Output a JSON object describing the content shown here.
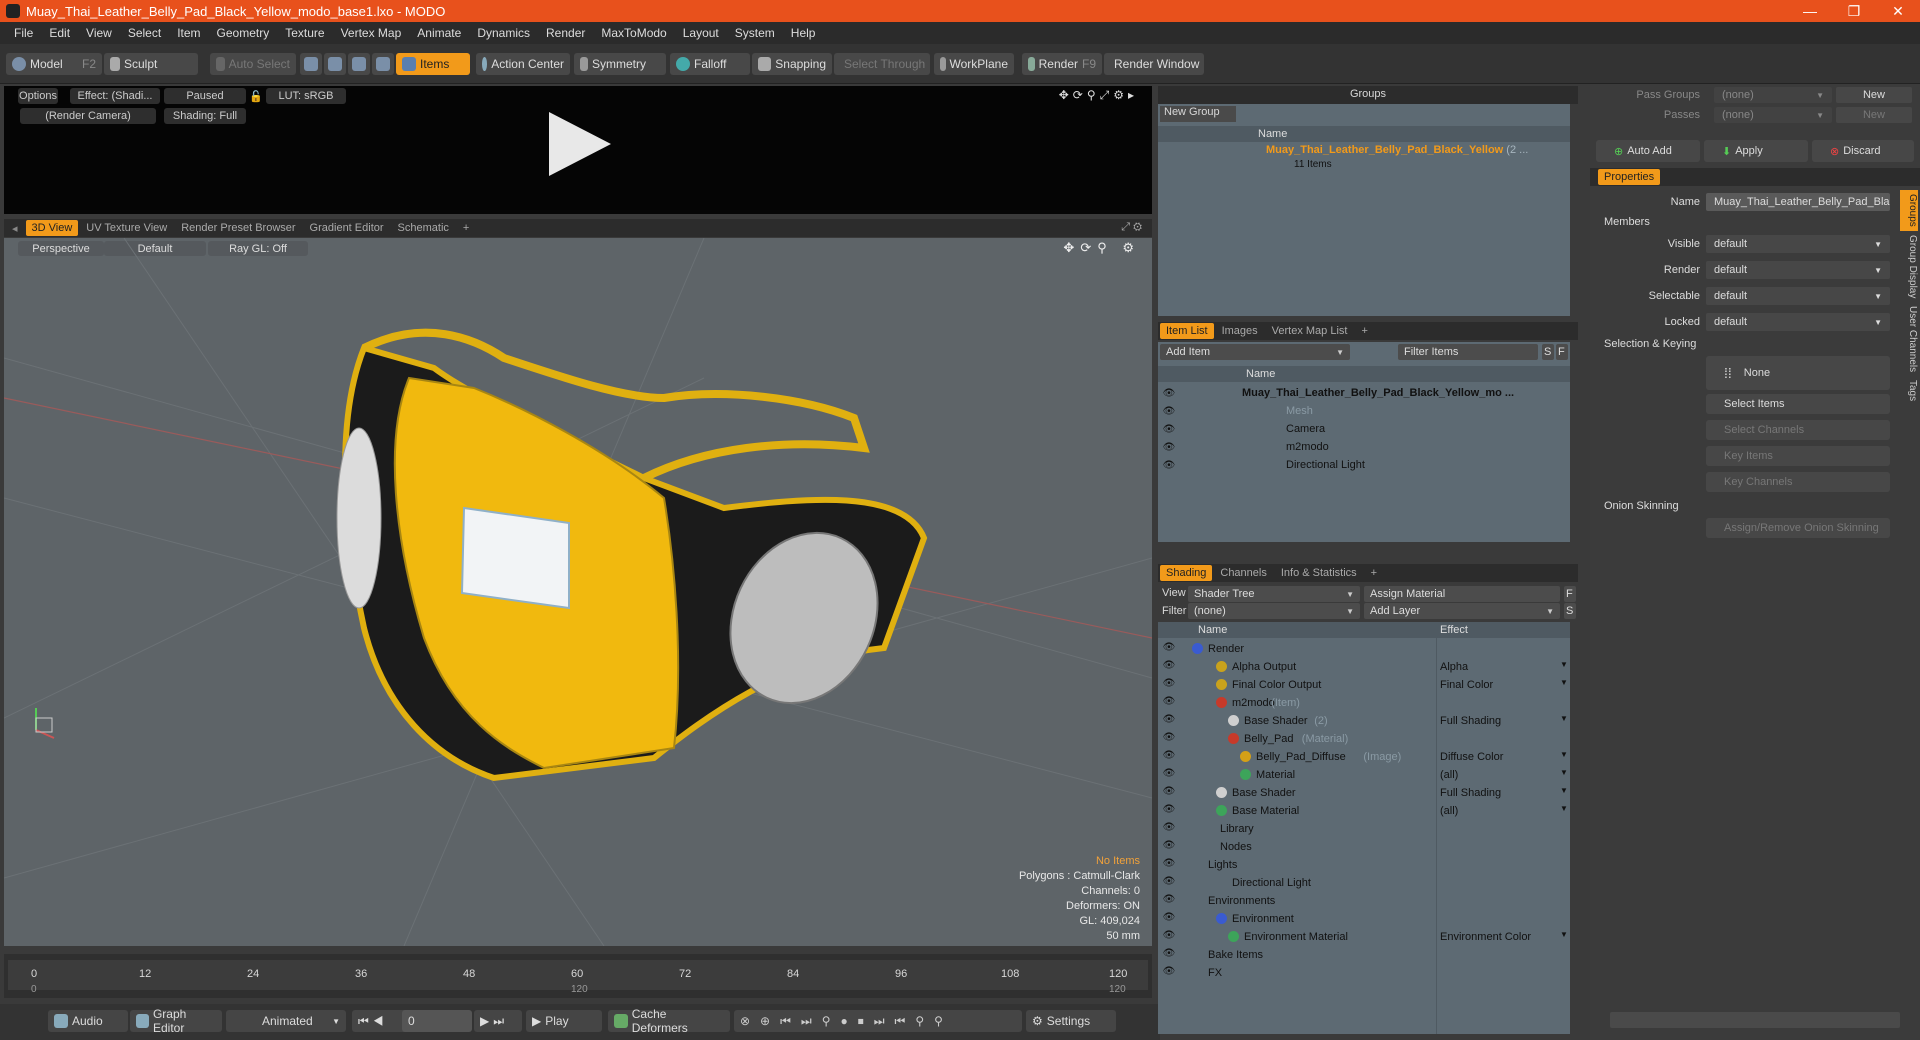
{
  "window": {
    "title": "Muay_Thai_Leather_Belly_Pad_Black_Yellow_modo_base1.lxo - MODO",
    "controls": [
      "—",
      "❐",
      "✕"
    ]
  },
  "menu": [
    "File",
    "Edit",
    "View",
    "Select",
    "Item",
    "Geometry",
    "Texture",
    "Vertex Map",
    "Animate",
    "Dynamics",
    "Render",
    "MaxToModo",
    "Layout",
    "System",
    "Help"
  ],
  "toolbar": {
    "model": "Model",
    "model_hotkey": "F2",
    "sculpt": "Sculpt",
    "auto_select": "Auto Select",
    "items": "Items",
    "action_center": "Action Center",
    "symmetry": "Symmetry",
    "falloff": "Falloff",
    "snapping": "Snapping",
    "select_through": "Select Through",
    "workplane": "WorkPlane",
    "render": "Render",
    "render_hotkey": "F9",
    "render_window": "Render Window"
  },
  "preview": {
    "options": "Options",
    "effect": "Effect: (Shadi...",
    "paused": "Paused",
    "lut": "LUT: sRGB",
    "camera": "(Render Camera)",
    "shading": "Shading: Full"
  },
  "view_tabs": [
    "3D View",
    "UV Texture View",
    "Render Preset Browser",
    "Gradient Editor",
    "Schematic",
    "+"
  ],
  "viewport": {
    "perspective": "Perspective",
    "default": "Default",
    "raygl": "Ray GL: Off",
    "info": {
      "no_items": "No Items",
      "polygons": "Polygons : Catmull-Clark",
      "channels": "Channels: 0",
      "deformers": "Deformers: ON",
      "gl": "GL: 409,024",
      "size": "50 mm"
    }
  },
  "timeline": {
    "ticks": [
      "0",
      "12",
      "24",
      "36",
      "48",
      "60",
      "72",
      "84",
      "96",
      "108",
      "120"
    ],
    "sub_ticks": [
      "0",
      "120",
      "120"
    ]
  },
  "bottombar": {
    "audio": "Audio",
    "graph_editor": "Graph Editor",
    "animated": "Animated",
    "frame": "0",
    "play": "Play",
    "cache_deformers": "Cache Deformers",
    "settings": "Settings"
  },
  "groups": {
    "title": "Groups",
    "new_group": "New Group",
    "col_name": "Name",
    "item_name": "Muay_Thai_Leather_Belly_Pad_Black_Yellow",
    "item_suffix": "(2 ...",
    "item_count": "11 Items"
  },
  "item_list": {
    "tabs": [
      "Item List",
      "Images",
      "Vertex Map List",
      "+"
    ],
    "add_item": "Add Item",
    "filter_items": "Filter Items",
    "s": "S",
    "f": "F",
    "col_name": "Name",
    "rows": [
      {
        "name": "Muay_Thai_Leather_Belly_Pad_Black_Yellow_mo ...",
        "bold": true,
        "indent": 0
      },
      {
        "name": "Mesh",
        "bold": false,
        "indent": 1,
        "dim": true
      },
      {
        "name": "Camera",
        "bold": false,
        "indent": 1
      },
      {
        "name": "m2modo",
        "bold": false,
        "indent": 1
      },
      {
        "name": "Directional Light",
        "bold": false,
        "indent": 1
      }
    ]
  },
  "shading": {
    "tabs": [
      "Shading",
      "Channels",
      "Info & Statistics",
      "+"
    ],
    "view_label": "View",
    "view_value": "Shader Tree",
    "assign_material": "Assign Material",
    "f": "F",
    "filter_label": "Filter",
    "filter_value": "(none)",
    "add_layer": "Add Layer",
    "s": "S",
    "col_name": "Name",
    "col_effect": "Effect",
    "rows": [
      {
        "name": "Render",
        "sub": "",
        "effect": "",
        "indent": 0,
        "dot": "#3a5bd0"
      },
      {
        "name": "Alpha Output",
        "sub": "",
        "effect": "Alpha",
        "indent": 2,
        "dot": "#c9a21c"
      },
      {
        "name": "Final Color Output",
        "sub": "",
        "effect": "Final Color",
        "indent": 2,
        "dot": "#c9a21c"
      },
      {
        "name": "m2modo",
        "sub": "(Item)",
        "effect": "",
        "indent": 2,
        "dot": "#c73a2a"
      },
      {
        "name": "Base Shader",
        "sub": "(2)",
        "effect": "Full Shading",
        "indent": 3,
        "dot": "#cfcfcf"
      },
      {
        "name": "Belly_Pad",
        "sub": "(Material)",
        "effect": "",
        "indent": 3,
        "dot": "#c73a2a"
      },
      {
        "name": "Belly_Pad_Diffuse",
        "sub": "(Image)",
        "effect": "Diffuse Color",
        "indent": 4,
        "dot": "#d4a017"
      },
      {
        "name": "Material",
        "sub": "",
        "effect": "(all)",
        "indent": 4,
        "dot": "#3da45a"
      },
      {
        "name": "Base Shader",
        "sub": "",
        "effect": "Full Shading",
        "indent": 2,
        "dot": "#cfcfcf"
      },
      {
        "name": "Base Material",
        "sub": "",
        "effect": "(all)",
        "indent": 2,
        "dot": "#3da45a"
      },
      {
        "name": "Library",
        "sub": "",
        "effect": "",
        "indent": 1,
        "dot": ""
      },
      {
        "name": "Nodes",
        "sub": "",
        "effect": "",
        "indent": 1,
        "dot": ""
      },
      {
        "name": "Lights",
        "sub": "",
        "effect": "",
        "indent": 0,
        "dot": ""
      },
      {
        "name": "Directional Light",
        "sub": "",
        "effect": "",
        "indent": 2,
        "dot": ""
      },
      {
        "name": "Environments",
        "sub": "",
        "effect": "",
        "indent": 0,
        "dot": ""
      },
      {
        "name": "Environment",
        "sub": "",
        "effect": "",
        "indent": 2,
        "dot": "#3a5bd0"
      },
      {
        "name": "Environment Material",
        "sub": "",
        "effect": "Environment Color",
        "indent": 3,
        "dot": "#3da45a"
      },
      {
        "name": "Bake Items",
        "sub": "",
        "effect": "",
        "indent": 0,
        "dot": ""
      },
      {
        "name": "FX",
        "sub": "",
        "effect": "",
        "indent": 0,
        "dot": ""
      }
    ]
  },
  "right": {
    "pass_groups": "Pass Groups",
    "passes": "Passes",
    "none": "(none)",
    "new": "New",
    "auto_add": "Auto Add",
    "apply": "Apply",
    "discard": "Discard",
    "properties_tab": "Properties",
    "name_label": "Name",
    "name_value": "Muay_Thai_Leather_Belly_Pad_Blac",
    "members": "Members",
    "visible": "Visible",
    "render": "Render",
    "selectable": "Selectable",
    "locked": "Locked",
    "default": "default",
    "selection_keying": "Selection & Keying",
    "none_btn": "None",
    "select_items": "Select Items",
    "select_channels": "Select Channels",
    "key_items": "Key Items",
    "key_channels": "Key Channels",
    "onion": "Onion Skinning",
    "assign_onion": "Assign/Remove Onion Skinning",
    "vtabs": [
      "Groups",
      "Group Display",
      "User Channels",
      "Tags"
    ]
  },
  "colors": {
    "accent": "#f29a1a",
    "titlebar": "#e8511c",
    "viewport": "#5e6468",
    "panel": "#5d6a73"
  }
}
